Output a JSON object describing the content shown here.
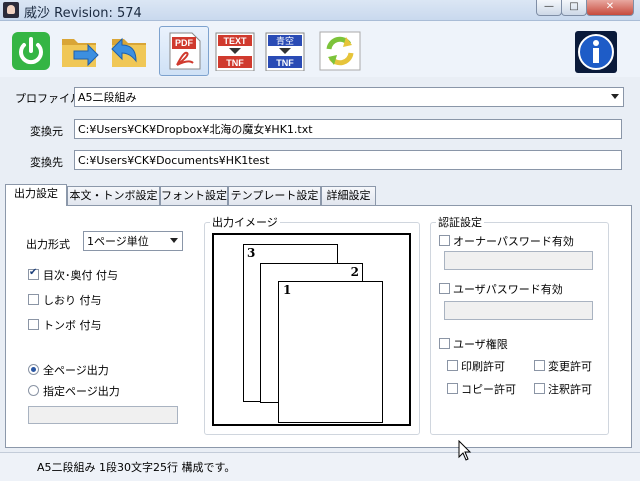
{
  "window": {
    "title": "威沙 Revision: 574",
    "min_glyph": "—",
    "max_glyph": "□",
    "close_glyph": "✕"
  },
  "toolbar": {
    "buttons": [
      {
        "name": "power-button",
        "icon": "power-icon",
        "color": "#2fae3b"
      },
      {
        "name": "open-folder-button",
        "icon": "folder-arrow-in-icon",
        "color": "#e2b340"
      },
      {
        "name": "save-folder-button",
        "icon": "folder-arrow-out-icon",
        "color": "#e2b340"
      },
      {
        "name": "pdf-button",
        "icon": "pdf-document-icon",
        "label": "PDF",
        "color": "#d03a2e"
      },
      {
        "name": "text-tnf-button",
        "icon": "text-to-tnf-icon",
        "label_top": "TEXT",
        "label_bottom": "TNF",
        "color": "#d03a2e"
      },
      {
        "name": "aozora-tnf-button",
        "icon": "aozora-to-tnf-icon",
        "label_top": "青空",
        "label_bottom": "TNF",
        "color": "#2a4bb5"
      },
      {
        "name": "refresh-button",
        "icon": "refresh-icon",
        "color": "#6cbf2f"
      },
      {
        "name": "info-button",
        "icon": "info-icon",
        "color": "#1e5cc7"
      }
    ]
  },
  "form": {
    "profile_label": "プロファイル",
    "profile_value": "A5二段組み",
    "source_label": "変換元",
    "source_value": "C:¥Users¥CK¥Dropbox¥北海の魔女¥HK1.txt",
    "dest_label": "変換先",
    "dest_value": "C:¥Users¥CK¥Documents¥HK1test"
  },
  "tabs": [
    "出力設定",
    "本文・トンボ設定",
    "フォント設定",
    "テンプレート設定",
    "詳細設定"
  ],
  "output": {
    "format_label": "出力形式",
    "format_value": "1ページ単位",
    "toc_label": "目次･奥付 付与",
    "bookmark_label": "しおり 付与",
    "tombo_label": "トンボ 付与",
    "all_pages_label": "全ページ出力",
    "specified_pages_label": "指定ページ出力",
    "specified_pages_value": ""
  },
  "preview": {
    "title": "出力イメージ",
    "page_numbers": [
      "3",
      "2",
      "1"
    ]
  },
  "auth": {
    "title": "認証設定",
    "owner_password_label": "オーナーパスワード有効",
    "owner_password_value": "",
    "user_password_label": "ユーザパスワード有効",
    "user_password_value": "",
    "user_rights_label": "ユーザ権限",
    "print_label": "印刷許可",
    "change_label": "変更許可",
    "copy_label": "コピー許可",
    "annotate_label": "注釈許可"
  },
  "status": {
    "text": "A5二段組み 1段30文字25行 構成です。"
  }
}
